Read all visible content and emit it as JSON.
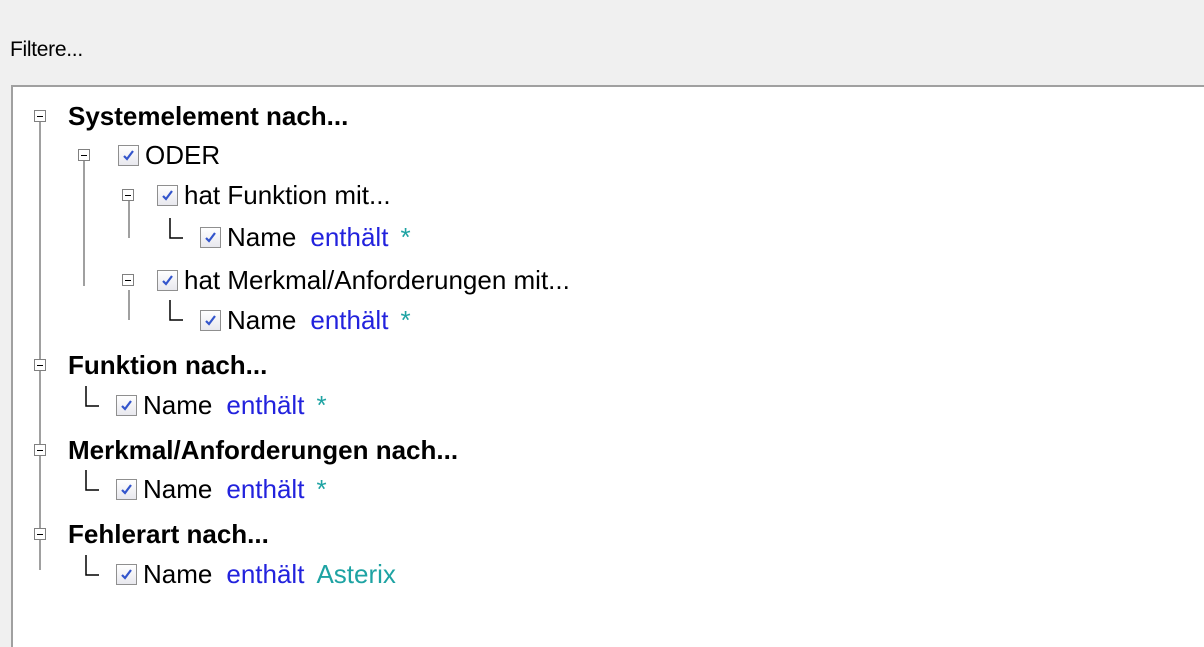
{
  "header": {
    "label": "Filtere..."
  },
  "tree": {
    "systemelement": {
      "label": "Systemelement nach...",
      "oder": {
        "label": "ODER",
        "checked": true,
        "funktion": {
          "label": "hat Funktion mit...",
          "checked": true,
          "condition": {
            "field": "Name",
            "op": "enthält",
            "value": "*",
            "checked": true
          }
        },
        "merkmal": {
          "label": "hat Merkmal/Anforderungen mit...",
          "checked": true,
          "condition": {
            "field": "Name",
            "op": "enthält",
            "value": "*",
            "checked": true
          }
        }
      }
    },
    "funktion": {
      "label": "Funktion nach...",
      "condition": {
        "field": "Name",
        "op": "enthält",
        "value": "*",
        "checked": true
      }
    },
    "merkmal": {
      "label": "Merkmal/Anforderungen nach...",
      "condition": {
        "field": "Name",
        "op": "enthält",
        "value": "*",
        "checked": true
      }
    },
    "fehlerart": {
      "label": "Fehlerart nach...",
      "condition": {
        "field": "Name",
        "op": "enthält",
        "value": "Asterix",
        "checked": true
      }
    }
  },
  "colors": {
    "operator": "#2222dd",
    "value": "#1ea3a3",
    "checkmark": "#3355cc"
  }
}
